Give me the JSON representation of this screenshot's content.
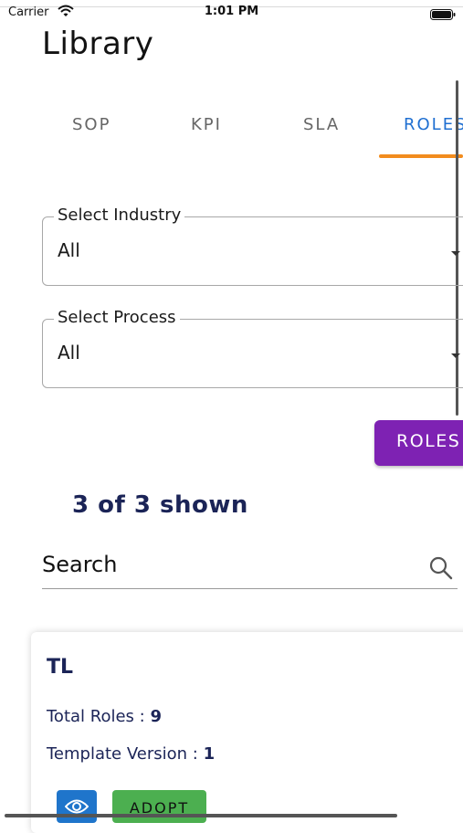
{
  "status_bar": {
    "carrier": "Carrier",
    "time": "1:01 PM",
    "wifi_icon": "wifi-icon",
    "battery_icon": "battery-icon"
  },
  "page": {
    "title": "Library"
  },
  "tabs": [
    {
      "label": "SOP",
      "active": false
    },
    {
      "label": "KPI",
      "active": false
    },
    {
      "label": "SLA",
      "active": false
    },
    {
      "label": "ROLES",
      "active": true
    }
  ],
  "filters": {
    "industry": {
      "label": "Select Industry",
      "value": "All"
    },
    "process": {
      "label": "Select Process",
      "value": "All"
    }
  },
  "roles_button": {
    "label": "ROLES"
  },
  "results": {
    "shown_text": "3 of 3 shown"
  },
  "search": {
    "placeholder": "Search",
    "value": "",
    "icon": "search-icon"
  },
  "cards": [
    {
      "title": "TL",
      "total_roles_label": "Total Roles : ",
      "total_roles_value": "9",
      "template_version_label": "Template Version : ",
      "template_version_value": "1",
      "view_icon": "eye-icon",
      "adopt_label": "ADOPT"
    }
  ],
  "colors": {
    "tab_active": "#1f6fd1",
    "tab_indicator": "#f28c1e",
    "roles_button": "#7e22b3",
    "view_button": "#1f75cb",
    "adopt_button": "#4caf50",
    "heading_navy": "#1b2457"
  }
}
